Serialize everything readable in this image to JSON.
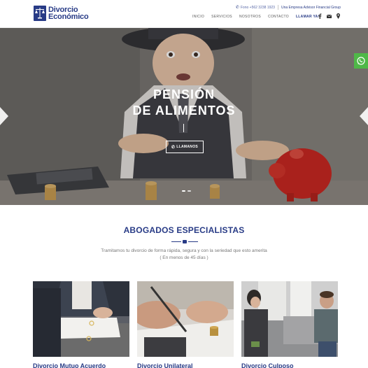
{
  "brand": {
    "name_line1": "Divorcio",
    "name_line2": "Económico",
    "color": "#283b86"
  },
  "topbar": {
    "phone": "Fono +562 3238 1923",
    "tagline": "Una Empresa Advisor Financial Group"
  },
  "nav": {
    "items": [
      "INICIO",
      "SERVICIOS",
      "NOSOTROS",
      "CONTACTO"
    ],
    "cta": "LLAMAR YA!",
    "icons": [
      "facebook-icon",
      "mail-icon",
      "map-pin-icon"
    ]
  },
  "hero": {
    "title_line1": "PENSIÓN",
    "title_line2": "DE ALIMENTOS",
    "button": "LLAMANOS",
    "slides": 2,
    "active_slide": 1
  },
  "whatsapp": {
    "icon": "whatsapp-icon",
    "color": "#4fb848"
  },
  "section": {
    "title": "ABOGADOS ESPECIALISTAS",
    "desc_line1": "Tramitamos tu divorcio de forma rápida, segura y con la seriedad que esto amerita",
    "desc_line2": "( En menos de 45 días )"
  },
  "cards": [
    {
      "title": "Divorcio Mutuo Acuerdo"
    },
    {
      "title": "Divorcio Unilateral"
    },
    {
      "title": "Divorcio Culposo"
    }
  ]
}
